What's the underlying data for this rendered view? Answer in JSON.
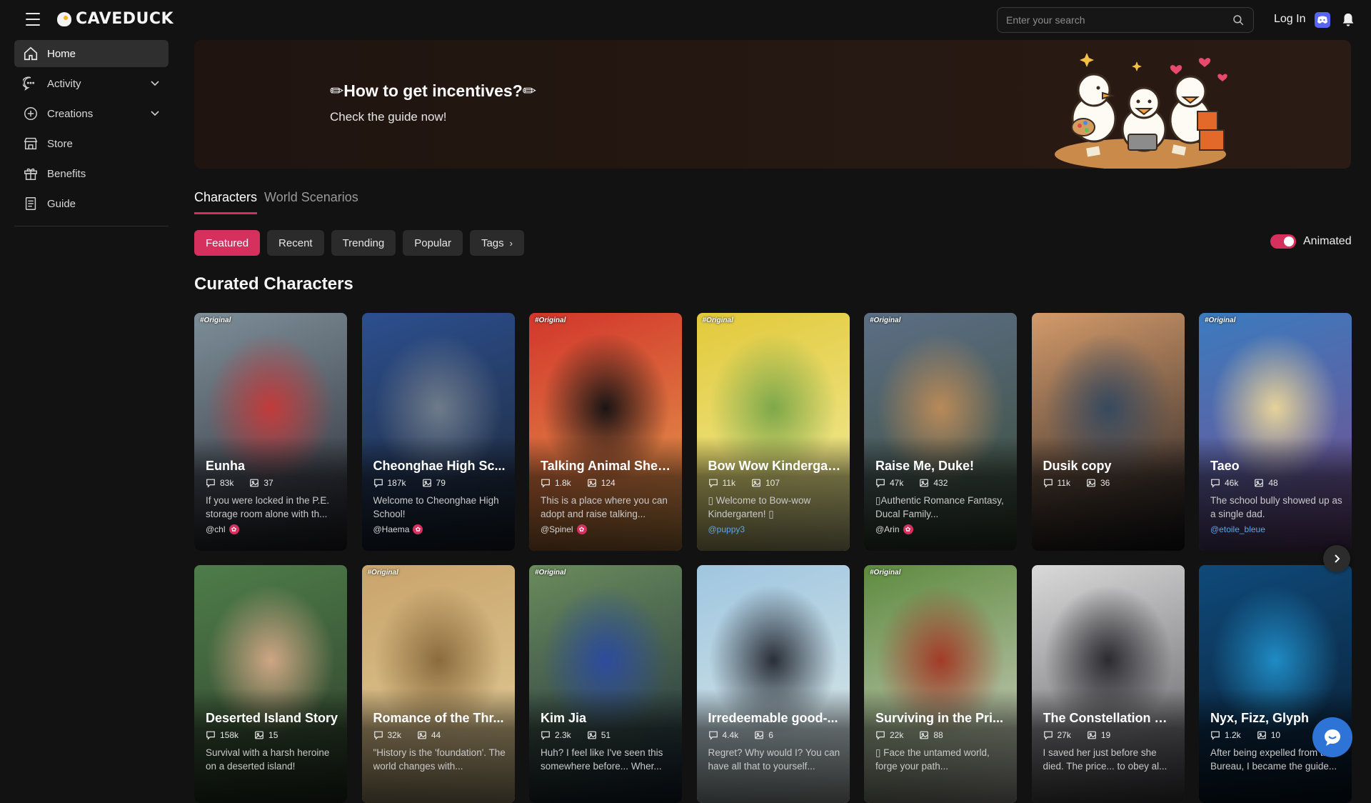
{
  "header": {
    "brand": "CAVEDUCK",
    "search_placeholder": "Enter your search",
    "login_label": "Log In"
  },
  "sidebar": {
    "items": [
      {
        "label": "Home",
        "icon": "home-icon"
      },
      {
        "label": "Activity",
        "icon": "chat-bubble-icon"
      },
      {
        "label": "Creations",
        "icon": "plus-circle-icon"
      },
      {
        "label": "Store",
        "icon": "store-icon"
      },
      {
        "label": "Benefits",
        "icon": "gift-icon"
      },
      {
        "label": "Guide",
        "icon": "document-icon"
      }
    ]
  },
  "banner": {
    "title": "✏How to get incentives?✏",
    "subtitle": "Check the guide now!"
  },
  "tabs": [
    "Characters",
    "World Scenarios"
  ],
  "filters": [
    "Featured",
    "Recent",
    "Trending",
    "Popular",
    "Tags"
  ],
  "animated_label": "Animated",
  "section_title": "Curated Characters",
  "colors": {
    "accent": "#d6305f",
    "background": "#121212",
    "surface": "#2b2b2b",
    "link_blue": "#5ba6e8"
  },
  "cards": [
    {
      "tag": "#Original",
      "name": "Eunha",
      "chats": "83k",
      "images": "37",
      "desc": "If you were locked in the P.E. storage room alone with th...",
      "author": "@chl"
    },
    {
      "tag": "",
      "name": "Cheonghae High Sc...",
      "chats": "187k",
      "images": "79",
      "desc": "Welcome to Cheonghae High School!",
      "author": "@Haema"
    },
    {
      "tag": "#Original",
      "name": "Talking Animal Shelter",
      "chats": "1.8k",
      "images": "124",
      "desc": "This is a place where you can adopt and raise talking...",
      "author": "@Spinel"
    },
    {
      "tag": "#Original",
      "name": "Bow Wow Kindergar...",
      "chats": "11k",
      "images": "107",
      "desc": "▯ Welcome to Bow-wow Kindergarten! ▯",
      "author": "@puppy3"
    },
    {
      "tag": "#Original",
      "name": "Raise Me, Duke!",
      "chats": "47k",
      "images": "432",
      "desc": "▯Authentic Romance Fantasy, Ducal Family...",
      "author": "@Arin"
    },
    {
      "tag": "",
      "name": "Dusik copy",
      "chats": "11k",
      "images": "36",
      "desc": "",
      "author": ""
    },
    {
      "tag": "#Original",
      "name": "Taeo",
      "chats": "46k",
      "images": "48",
      "desc": "The school bully showed up as a single dad.",
      "author": "@etoile_bleue"
    },
    {
      "tag": "",
      "name": "Deserted Island Story",
      "chats": "158k",
      "images": "15",
      "desc": "Survival with a harsh heroine on a deserted island!",
      "author": ""
    },
    {
      "tag": "#Original",
      "name": "Romance of the Thr...",
      "chats": "32k",
      "images": "44",
      "desc": "\"History is the 'foundation'. The world changes with...",
      "author": ""
    },
    {
      "tag": "#Original",
      "name": "Kim Jia",
      "chats": "2.3k",
      "images": "51",
      "desc": "Huh? I feel like I've seen this somewhere before... Wher...",
      "author": ""
    },
    {
      "tag": "",
      "name": "Irredeemable good-...",
      "chats": "4.4k",
      "images": "6",
      "desc": "Regret? Why would I? You can have all that to yourself...",
      "author": ""
    },
    {
      "tag": "#Original",
      "name": "Surviving in the Pri...",
      "chats": "22k",
      "images": "88",
      "desc": "▯ Face the untamed world, forge your path...",
      "author": ""
    },
    {
      "tag": "",
      "name": "The Constellation W...",
      "chats": "27k",
      "images": "19",
      "desc": "I saved her just before she died. The price... to obey al...",
      "author": ""
    },
    {
      "tag": "",
      "name": "Nyx, Fizz, Glyph",
      "chats": "1.2k",
      "images": "10",
      "desc": "After being expelled from the Bureau, I became the guide...",
      "author": ""
    }
  ]
}
